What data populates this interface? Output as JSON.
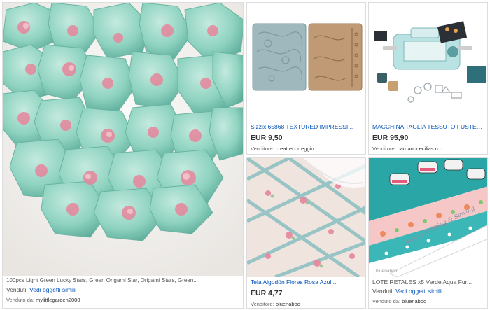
{
  "big_item": {
    "title": "100pcs Light Green Lucky Stars, Green Origami Star, Origami Stars, Green...",
    "sold_label": "Venduti.",
    "similar_link": "Vedi oggetti simili",
    "seller_label": "Venduto da:",
    "seller_name": "mylittlegarden2008"
  },
  "items": [
    {
      "title": "Sizzix 65868 TEXTURED IMPRESSI...",
      "price": "EUR 9,50",
      "seller_label": "Venditore:",
      "seller_name": "creatrecorreggio"
    },
    {
      "title": "MACCHINA TAGLIA TESSUTO FUSTEL...",
      "price": "EUR 95,90",
      "seller_label": "Venditore:",
      "seller_name": "cardanocecilias.n.c"
    },
    {
      "title": "Tela Algodón Flores Rosa Azul...",
      "price": "EUR 4,77",
      "seller_label": "Venditore:",
      "seller_name": "bluenaboo"
    },
    {
      "title": "LOTE RETALES x5 Verde Aqua Fur...",
      "sold_label": "Venduti.",
      "similar_link": "Vedi oggetti simili",
      "seller_label": "Venduto da:",
      "seller_name": "bluenaboo",
      "image_caption": "Always Knitting & Sewing",
      "image_watermark": "bluenaboo"
    }
  ],
  "colors": {
    "link": "#0654ba",
    "border": "#dddddd",
    "mint": "#8fd3c0",
    "pink": "#e7869c",
    "emboss_blue": "#9fb8bd",
    "emboss_kraft": "#bf9a74"
  }
}
